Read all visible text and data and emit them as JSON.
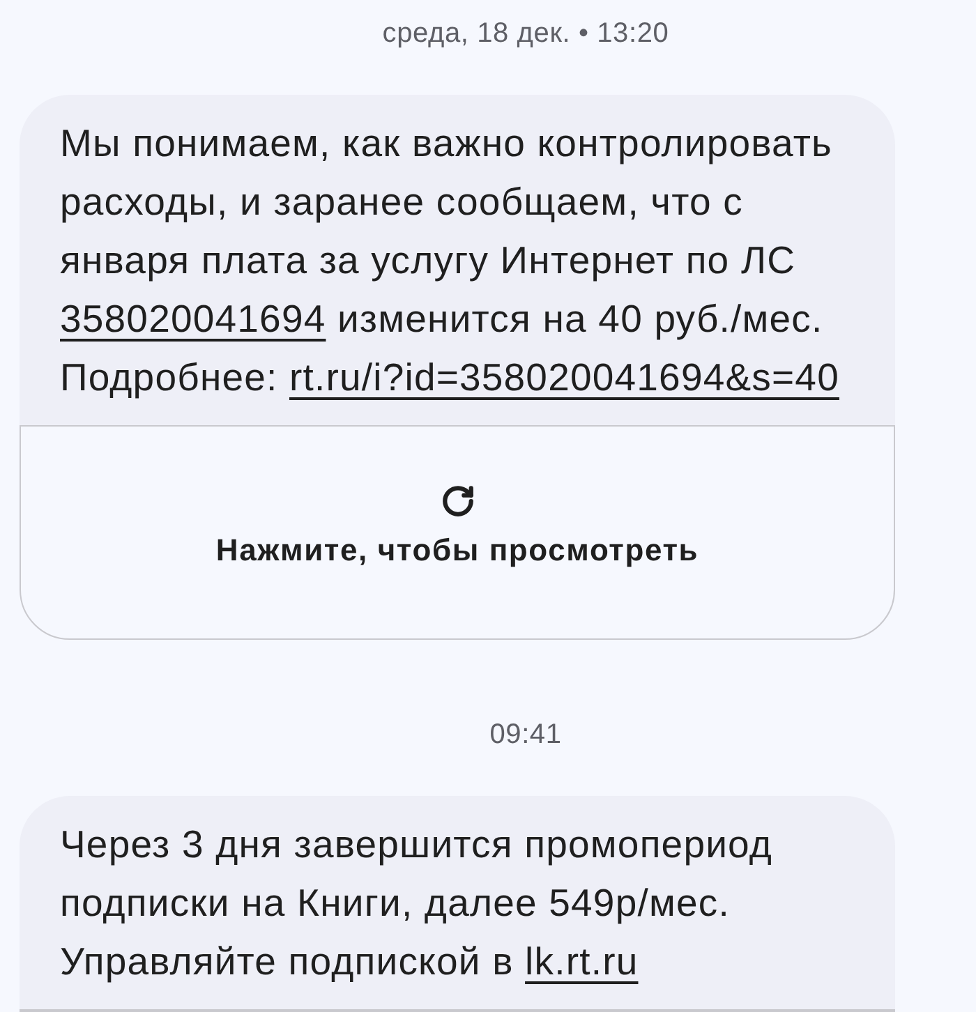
{
  "messages": [
    {
      "timestamp": "среда, 18 дек. • 13:20",
      "parts": [
        {
          "kind": "text",
          "text": "Мы понимаем, как важно контролировать расходы, и заранее сообщаем, что с января плата за услугу Интернет по ЛС "
        },
        {
          "kind": "link",
          "text": "358020041694"
        },
        {
          "kind": "text",
          "text": " изменится на 40 руб./мес. Подробнее: "
        },
        {
          "kind": "link",
          "text": "rt.ru/i?id=358020041694&s=40"
        }
      ],
      "has_preview": true,
      "preview_label": "Нажмите, чтобы просмотреть"
    },
    {
      "timestamp": "09:41",
      "parts": [
        {
          "kind": "text",
          "text": "Через 3 дня завершится промопериод подписки на Книги, далее 549р/мес. Управляйте подпиской в "
        },
        {
          "kind": "link",
          "text": "lk.rt.ru"
        }
      ],
      "has_preview": true
    }
  ]
}
